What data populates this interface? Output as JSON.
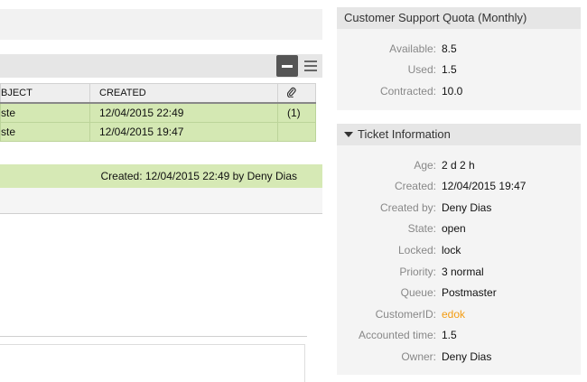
{
  "articles": {
    "columns": [
      "BJECT",
      "CREATED",
      "attachment-icon"
    ],
    "rows": [
      {
        "subject": "ste",
        "created": "12/04/2015 22:49",
        "attachments": "(1)"
      },
      {
        "subject": "ste",
        "created": "12/04/2015 19:47",
        "attachments": ""
      }
    ]
  },
  "article": {
    "meta": "Created: 12/04/2015 22:49 by Deny Dias"
  },
  "quota": {
    "title": "Customer Support Quota (Monthly)",
    "available_label": "Available:",
    "available": "8.5",
    "used_label": "Used:",
    "used": "1.5",
    "contracted_label": "Contracted:",
    "contracted": "10.0"
  },
  "ticket_info": {
    "title": "Ticket Information",
    "age_label": "Age:",
    "age": "2 d 2 h",
    "created_label": "Created:",
    "created": "12/04/2015 19:47",
    "created_by_label": "Created by:",
    "created_by": "Deny Dias",
    "state_label": "State:",
    "state": "open",
    "locked_label": "Locked:",
    "locked": "lock",
    "priority_label": "Priority:",
    "priority": "3 normal",
    "queue_label": "Queue:",
    "queue": "Postmaster",
    "customer_label": "CustomerID:",
    "customer": "edok",
    "accounted_label": "Accounted time:",
    "accounted": "1.5",
    "owner_label": "Owner:",
    "owner": "Deny Dias"
  },
  "colors": {
    "accent_link": "#f39c12",
    "row_green": "#d4e8b3"
  }
}
